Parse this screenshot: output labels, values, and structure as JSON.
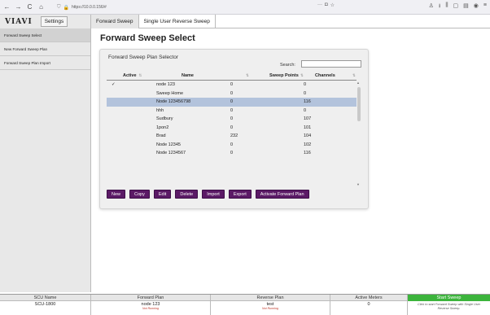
{
  "browser": {
    "url": "https://10.0.0.156/#",
    "url_more": "···",
    "nav": {
      "back": "←",
      "forward": "→",
      "reload": "C",
      "home": "⌂"
    }
  },
  "header": {
    "logo": "VIAVI",
    "settings": "Settings",
    "tabs": [
      {
        "label": "Forward Sweep",
        "active": true
      },
      {
        "label": "Single User Reverse Sweep",
        "active": false
      }
    ]
  },
  "sidebar": {
    "items": [
      {
        "label": "Forward Sweep Select",
        "active": true
      },
      {
        "label": "New Forward Sweep Plan",
        "active": false
      },
      {
        "label": "Forward Sweep Plan Import",
        "active": false
      }
    ]
  },
  "main": {
    "title": "Forward Sweep Select",
    "panel_title": "Forward Sweep Plan Selector",
    "search_label": "Search:",
    "search_value": "",
    "columns": {
      "active": "Active",
      "name": "Name",
      "points": "Sweep Points",
      "channels": "Channels"
    },
    "rows": [
      {
        "active": "✓",
        "name": "node 123",
        "points": "0",
        "channels": "0",
        "selected": false
      },
      {
        "active": "",
        "name": "Sweep Home",
        "points": "0",
        "channels": "0",
        "selected": false
      },
      {
        "active": "",
        "name": "Node 123456798",
        "points": "0",
        "channels": "116",
        "selected": true
      },
      {
        "active": "",
        "name": "hhh",
        "points": "0",
        "channels": "0",
        "selected": false
      },
      {
        "active": "",
        "name": "Sudbury",
        "points": "0",
        "channels": "107",
        "selected": false
      },
      {
        "active": "",
        "name": "1pon2",
        "points": "0",
        "channels": "101",
        "selected": false
      },
      {
        "active": "",
        "name": "Brad",
        "points": "232",
        "channels": "104",
        "selected": false
      },
      {
        "active": "",
        "name": "Node 12345",
        "points": "0",
        "channels": "102",
        "selected": false
      },
      {
        "active": "",
        "name": "Node 1234567",
        "points": "0",
        "channels": "116",
        "selected": false
      }
    ],
    "buttons": [
      "New",
      "Copy",
      "Edit",
      "Delete",
      "Import",
      "Export",
      "Activate Forward Plan"
    ]
  },
  "footer": {
    "scu_name_label": "SCU Name",
    "scu_name_value": "SCU-1800",
    "forward_label": "Forward Plan",
    "forward_value": "node 123",
    "forward_status": "Not Running",
    "reverse_label": "Reverse Plan",
    "reverse_value": "test",
    "reverse_status": "Not Running",
    "meters_label": "Active Meters",
    "meters_value": "0",
    "start_label": "Start Sweep",
    "start_note": "Click to start Forward Sweep with Single User Reverse Sweep."
  },
  "colors": {
    "button": "#5b1a66",
    "selected_row": "#b3c3dc",
    "start": "#3cb43c",
    "not_running": "#c0392b"
  }
}
